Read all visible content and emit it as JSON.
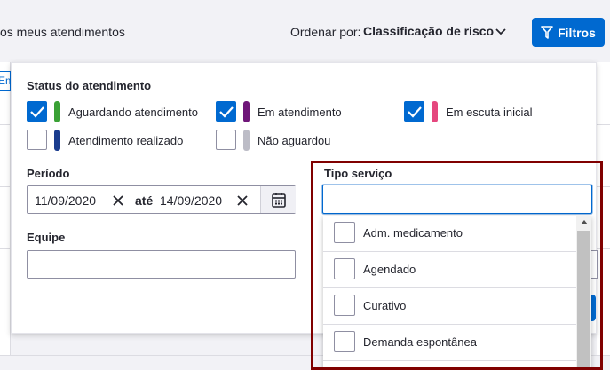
{
  "header": {
    "meus_atendimentos": "os meus atendimentos",
    "ordenar_label": "Ordenar por:",
    "ordenar_value": "Classificação de risco",
    "filtros_label": "Filtros"
  },
  "background": {
    "em_tab_fragment": "Em"
  },
  "filters": {
    "status_title": "Status do atendimento",
    "status_options": [
      {
        "label": "Aguardando atendimento",
        "checked": true,
        "color": "#3aa135"
      },
      {
        "label": "Em atendimento",
        "checked": true,
        "color": "#6f1679"
      },
      {
        "label": "Em escuta inicial",
        "checked": true,
        "color": "#e5477e"
      },
      {
        "label": "Atendimento realizado",
        "checked": false,
        "color": "#1a3c8e"
      },
      {
        "label": "Não aguardou",
        "checked": false,
        "color": "#bcbcc6"
      }
    ],
    "periodo_title": "Período",
    "periodo_start": "11/09/2020",
    "periodo_sep": "até",
    "periodo_end": "14/09/2020",
    "equipe_title": "Equipe",
    "equipe_value": "",
    "tipo_servico_title": "Tipo serviço",
    "tipo_servico_value": "",
    "tipo_servico_options": [
      "Adm. medicamento",
      "Agendado",
      "Curativo",
      "Demanda espontânea"
    ]
  },
  "colors": {
    "accent": "#0069d0",
    "highlight": "#800000"
  }
}
